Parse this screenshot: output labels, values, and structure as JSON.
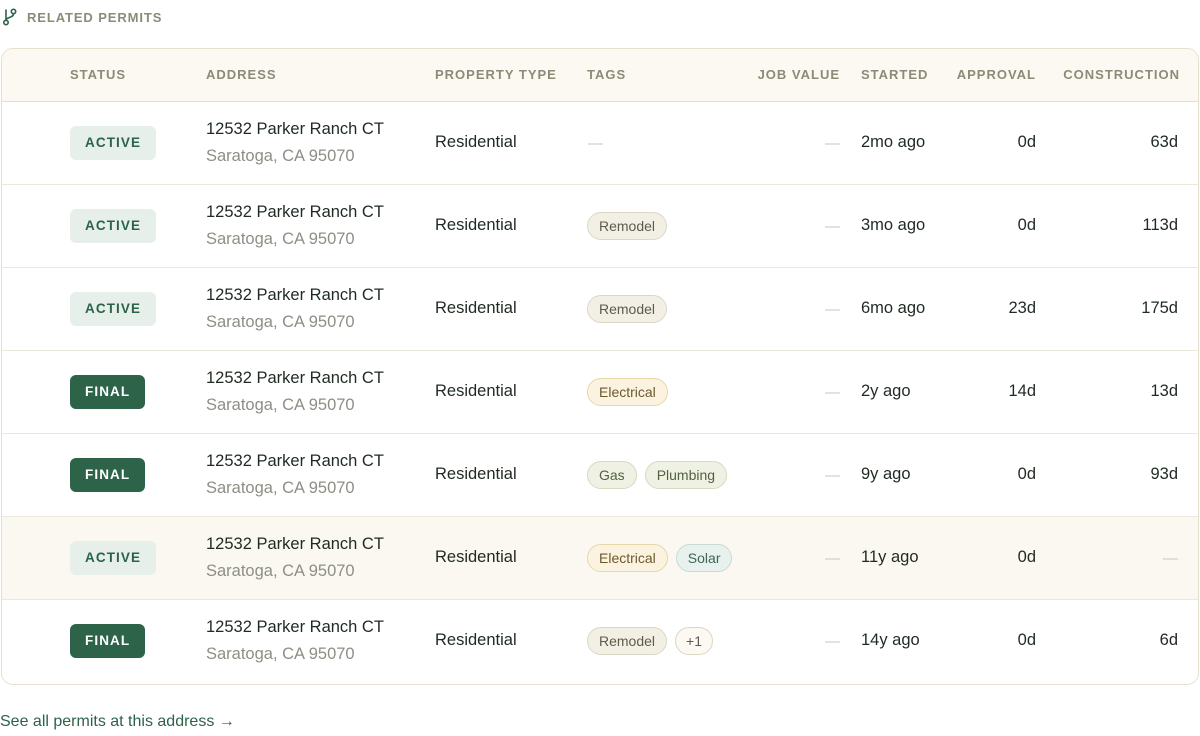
{
  "section": {
    "title": "RELATED PERMITS",
    "icon": "branch-icon"
  },
  "columns": {
    "status": "STATUS",
    "address": "ADDRESS",
    "property_type": "PROPERTY TYPE",
    "tags": "TAGS",
    "job_value": "JOB VALUE",
    "started": "STARTED",
    "approval": "APPROVAL",
    "construction": "CONSTRUCTION"
  },
  "rows": [
    {
      "status": "ACTIVE",
      "status_kind": "active",
      "address_line1": "12532 Parker Ranch CT",
      "address_line2": "Saratoga, CA 95070",
      "property_type": "Residential",
      "tags": [],
      "tags_empty": "—",
      "job_value": "—",
      "started": "2mo ago",
      "approval": "0d",
      "construction": "63d"
    },
    {
      "status": "ACTIVE",
      "status_kind": "active",
      "address_line1": "12532 Parker Ranch CT",
      "address_line2": "Saratoga, CA 95070",
      "property_type": "Residential",
      "tags": [
        {
          "label": "Remodel",
          "kind": "remodel"
        }
      ],
      "job_value": "—",
      "started": "3mo ago",
      "approval": "0d",
      "construction": "113d"
    },
    {
      "status": "ACTIVE",
      "status_kind": "active",
      "address_line1": "12532 Parker Ranch CT",
      "address_line2": "Saratoga, CA 95070",
      "property_type": "Residential",
      "tags": [
        {
          "label": "Remodel",
          "kind": "remodel"
        }
      ],
      "job_value": "—",
      "started": "6mo ago",
      "approval": "23d",
      "construction": "175d"
    },
    {
      "status": "FINAL",
      "status_kind": "final",
      "address_line1": "12532 Parker Ranch CT",
      "address_line2": "Saratoga, CA 95070",
      "property_type": "Residential",
      "tags": [
        {
          "label": "Electrical",
          "kind": "electrical"
        }
      ],
      "job_value": "—",
      "started": "2y ago",
      "approval": "14d",
      "construction": "13d"
    },
    {
      "status": "FINAL",
      "status_kind": "final",
      "address_line1": "12532 Parker Ranch CT",
      "address_line2": "Saratoga, CA 95070",
      "property_type": "Residential",
      "tags": [
        {
          "label": "Gas",
          "kind": "gas"
        },
        {
          "label": "Plumbing",
          "kind": "plumbing"
        }
      ],
      "job_value": "—",
      "started": "9y ago",
      "approval": "0d",
      "construction": "93d"
    },
    {
      "status": "ACTIVE",
      "status_kind": "active",
      "address_line1": "12532 Parker Ranch CT",
      "address_line2": "Saratoga, CA 95070",
      "property_type": "Residential",
      "tags": [
        {
          "label": "Electrical",
          "kind": "electrical"
        },
        {
          "label": "Solar",
          "kind": "solar"
        }
      ],
      "job_value": "—",
      "started": "11y ago",
      "approval": "0d",
      "construction": "—",
      "hovered": true
    },
    {
      "status": "FINAL",
      "status_kind": "final",
      "address_line1": "12532 Parker Ranch CT",
      "address_line2": "Saratoga, CA 95070",
      "property_type": "Residential",
      "tags": [
        {
          "label": "Remodel",
          "kind": "remodel"
        },
        {
          "label": "+1",
          "kind": "more"
        }
      ],
      "job_value": "—",
      "started": "14y ago",
      "approval": "0d",
      "construction": "6d"
    }
  ],
  "footer": {
    "link_label": "See all permits at this address →"
  },
  "colors": {
    "brand_green": "#2c6349",
    "header_text": "#8b8b77",
    "border": "#e6e1cf"
  }
}
